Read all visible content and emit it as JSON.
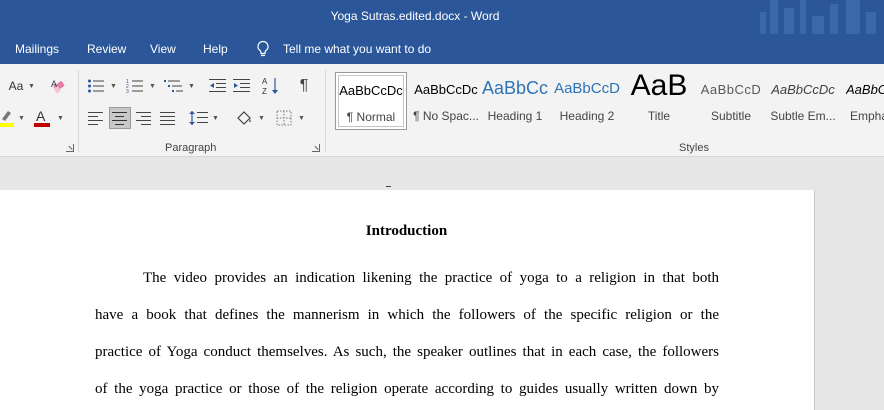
{
  "window": {
    "title": "Yoga Sutras.edited.docx  -  Word"
  },
  "tabs": [
    {
      "label": "Mailings"
    },
    {
      "label": "Review"
    },
    {
      "label": "View"
    },
    {
      "label": "Help"
    }
  ],
  "tell_me": {
    "placeholder": "Tell me what you want to do"
  },
  "font_group": {
    "change_case_label": "Aa"
  },
  "paragraph_group": {
    "label": "Paragraph"
  },
  "styles_group": {
    "label": "Styles",
    "items": [
      {
        "preview": "AaBbCcDc",
        "name": "¶ Normal",
        "selected": true
      },
      {
        "preview": "AaBbCcDc",
        "name": "¶ No Spac..."
      },
      {
        "preview": "AaBbCc",
        "name": "Heading 1",
        "color": "#2e74b5"
      },
      {
        "preview": "AaBbCcD",
        "name": "Heading 2",
        "color": "#2e74b5"
      },
      {
        "preview": "AaB",
        "name": "Title"
      },
      {
        "preview": "AaBbCcD",
        "name": "Subtitle",
        "color": "#595959"
      },
      {
        "preview": "AaBbCcDc",
        "name": "Subtle Em...",
        "color": "#404040"
      },
      {
        "preview": "AaBbC",
        "name": "Empha",
        "color": "#000000"
      }
    ]
  },
  "colors": {
    "accent": "#2b579a",
    "highlight": "#ffff00",
    "font_color": "#c00000"
  },
  "document": {
    "heading": "Introduction",
    "lines": [
      "The video provides an indication likening the practice of yoga to a religion in that both",
      "have a book that defines the mannerism in which the followers of the specific religion or the",
      "practice of Yoga conduct themselves. As such, the speaker outlines that in each case, the followers",
      "of the yoga practice or those of the religion operate according to guides usually written down by"
    ]
  }
}
